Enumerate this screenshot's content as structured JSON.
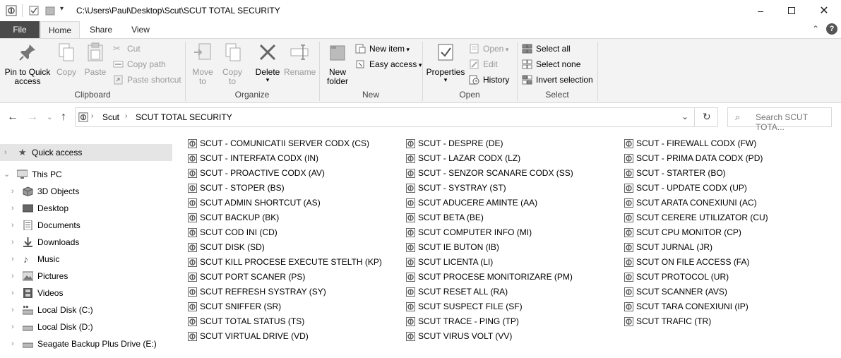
{
  "window": {
    "title": "C:\\Users\\Paul\\Desktop\\Scut\\SCUT TOTAL SECURITY"
  },
  "tabs": [
    "File",
    "Home",
    "Share",
    "View"
  ],
  "ribbon": {
    "clipboard": {
      "label": "Clipboard",
      "pin": "Pin to Quick\naccess",
      "copy": "Copy",
      "paste": "Paste",
      "cut": "Cut",
      "copy_path": "Copy path",
      "paste_shortcut": "Paste shortcut"
    },
    "organize": {
      "label": "Organize",
      "move_to": "Move\nto",
      "copy_to": "Copy\nto",
      "delete": "Delete",
      "rename": "Rename"
    },
    "new": {
      "label": "New",
      "new_folder": "New\nfolder",
      "new_item": "New item",
      "easy_access": "Easy access"
    },
    "open": {
      "label": "Open",
      "properties": "Properties",
      "open": "Open",
      "edit": "Edit",
      "history": "History"
    },
    "select": {
      "label": "Select",
      "select_all": "Select all",
      "select_none": "Select none",
      "invert_selection": "Invert selection"
    }
  },
  "address": {
    "crumbs": [
      "Scut",
      "SCUT TOTAL SECURITY"
    ],
    "search_placeholder": "Search SCUT TOTA..."
  },
  "navpane": {
    "quick_access": "Quick access",
    "this_pc": "This PC",
    "items": [
      "3D Objects",
      "Desktop",
      "Documents",
      "Downloads",
      "Music",
      "Pictures",
      "Videos",
      "Local Disk (C:)",
      "Local Disk (D:)",
      "Seagate Backup Plus Drive (E:)"
    ]
  },
  "files": {
    "col1": [
      "SCUT - COMUNICATII SERVER CODX (CS)",
      "SCUT - INTERFATA CODX (IN)",
      "SCUT - PROACTIVE CODX (AV)",
      "SCUT - STOPER (BS)",
      "SCUT ADMIN SHORTCUT (AS)",
      "SCUT BACKUP (BK)",
      "SCUT COD INI (CD)",
      "SCUT DISK (SD)",
      "SCUT KILL PROCESE EXECUTE STELTH (KP)",
      "SCUT PORT SCANER (PS)",
      "SCUT REFRESH SYSTRAY (SY)",
      "SCUT SNIFFER (SR)",
      "SCUT TOTAL STATUS  (TS)",
      "SCUT VIRTUAL DRIVE (VD)"
    ],
    "col2": [
      "SCUT - DESPRE (DE)",
      "SCUT - LAZAR CODX (LZ)",
      "SCUT - SENZOR SCANARE CODX (SS)",
      "SCUT - SYSTRAY (ST)",
      "SCUT ADUCERE AMINTE (AA)",
      "SCUT BETA (BE)",
      "SCUT COMPUTER INFO (MI)",
      "SCUT IE BUTON (IB)",
      "SCUT LICENTA (LI)",
      "SCUT PROCESE MONITORIZARE (PM)",
      "SCUT RESET ALL (RA)",
      "SCUT SUSPECT FILE (SF)",
      "SCUT TRACE -  PING (TP)",
      "SCUT VIRUS VOLT (VV)"
    ],
    "col3": [
      "SCUT - FIREWALL CODX (FW)",
      "SCUT - PRIMA DATA CODX (PD)",
      "SCUT - STARTER (BO)",
      "SCUT - UPDATE CODX (UP)",
      "SCUT ARATA CONEXIUNI (AC)",
      "SCUT CERERE UTILIZATOR (CU)",
      "SCUT CPU MONITOR (CP)",
      "SCUT JURNAL (JR)",
      "SCUT ON FILE ACCESS (FA)",
      "SCUT PROTOCOL (UR)",
      "SCUT SCANNER (AVS)",
      "SCUT TARA CONEXIUNI (IP)",
      "SCUT TRAFIC (TR)"
    ]
  },
  "colors": {
    "file_tab": "#4a4a4a",
    "ribbon_bg": "#f3f3f3",
    "disabled_text": "#9a9a9a",
    "selected_nav": "#e5e5e5"
  }
}
